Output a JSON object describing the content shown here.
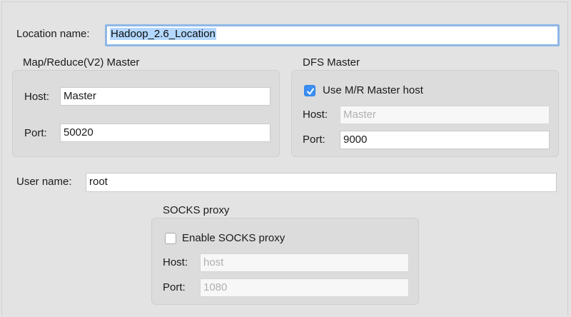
{
  "location": {
    "label": "Location name:",
    "value": "Hadoop_2.6_Location"
  },
  "mapreduce": {
    "title": "Map/Reduce(V2) Master",
    "host_label": "Host:",
    "host_value": "Master",
    "port_label": "Port:",
    "port_value": "50020"
  },
  "dfs": {
    "title": "DFS Master",
    "use_mr_label": "Use M/R Master host",
    "use_mr_checked": true,
    "host_label": "Host:",
    "host_value": "Master",
    "port_label": "Port:",
    "port_value": "9000"
  },
  "user": {
    "label": "User name:",
    "value": "root"
  },
  "socks": {
    "title": "SOCKS proxy",
    "enable_label": "Enable SOCKS proxy",
    "enable_checked": false,
    "host_label": "Host:",
    "host_placeholder": "host",
    "port_label": "Port:",
    "port_placeholder": "1080"
  },
  "colors": {
    "background": "#e3e3e3",
    "group_background": "#dcdcdc",
    "focus_ring": "#8fb7e6",
    "selection": "#b3d7ff",
    "checkbox_accent": "#3b8ef3"
  }
}
